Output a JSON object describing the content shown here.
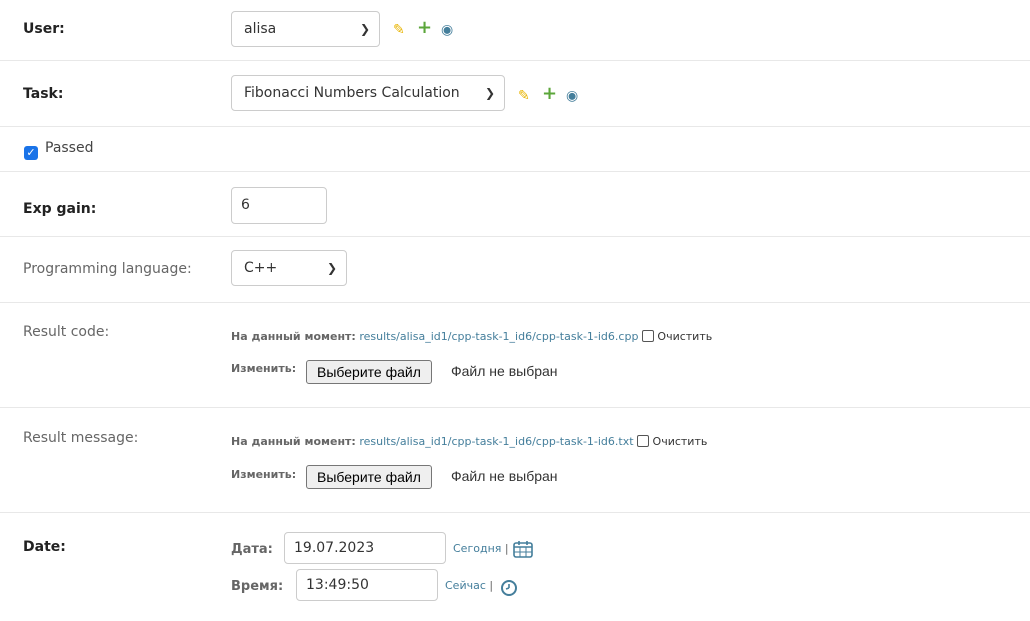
{
  "user": {
    "label": "User:",
    "value": "alisa"
  },
  "task": {
    "label": "Task:",
    "value": "Fibonacci Numbers Calculation"
  },
  "passed": {
    "label": "Passed",
    "checked": true
  },
  "exp_gain": {
    "label": "Exp gain:",
    "value": "6"
  },
  "programming_language": {
    "label": "Programming language:",
    "value": "C++"
  },
  "result_code": {
    "label": "Result code:",
    "current_label": "На данный момент:",
    "current_link": "results/alisa_id1/cpp-task-1_id6/cpp-task-1-id6.cpp",
    "clear_label": "Очистить",
    "change_label": "Изменить:",
    "choose_button": "Выберите файл",
    "no_file": "Файл не выбран"
  },
  "result_message": {
    "label": "Result message:",
    "current_label": "На данный момент:",
    "current_link": "results/alisa_id1/cpp-task-1_id6/cpp-task-1-id6.txt",
    "clear_label": "Очистить",
    "change_label": "Изменить:",
    "choose_button": "Выберите файл",
    "no_file": "Файл не выбран"
  },
  "date": {
    "label": "Date:",
    "date_label": "Дата:",
    "date_value": "19.07.2023",
    "today_link": "Сегодня",
    "time_label": "Время:",
    "time_value": "13:49:50",
    "now_link": "Сейчас",
    "separator": "|"
  },
  "icons": {
    "pencil": "pencil-icon",
    "plus": "plus-icon",
    "eye": "eye-icon",
    "calendar": "calendar-icon",
    "clock": "clock-icon",
    "chevron": "chevron-down-icon"
  },
  "colors": {
    "link": "#447e9b",
    "pencil": "#e8b400",
    "plus": "#5ba63a",
    "checkbox": "#1a73e8"
  }
}
